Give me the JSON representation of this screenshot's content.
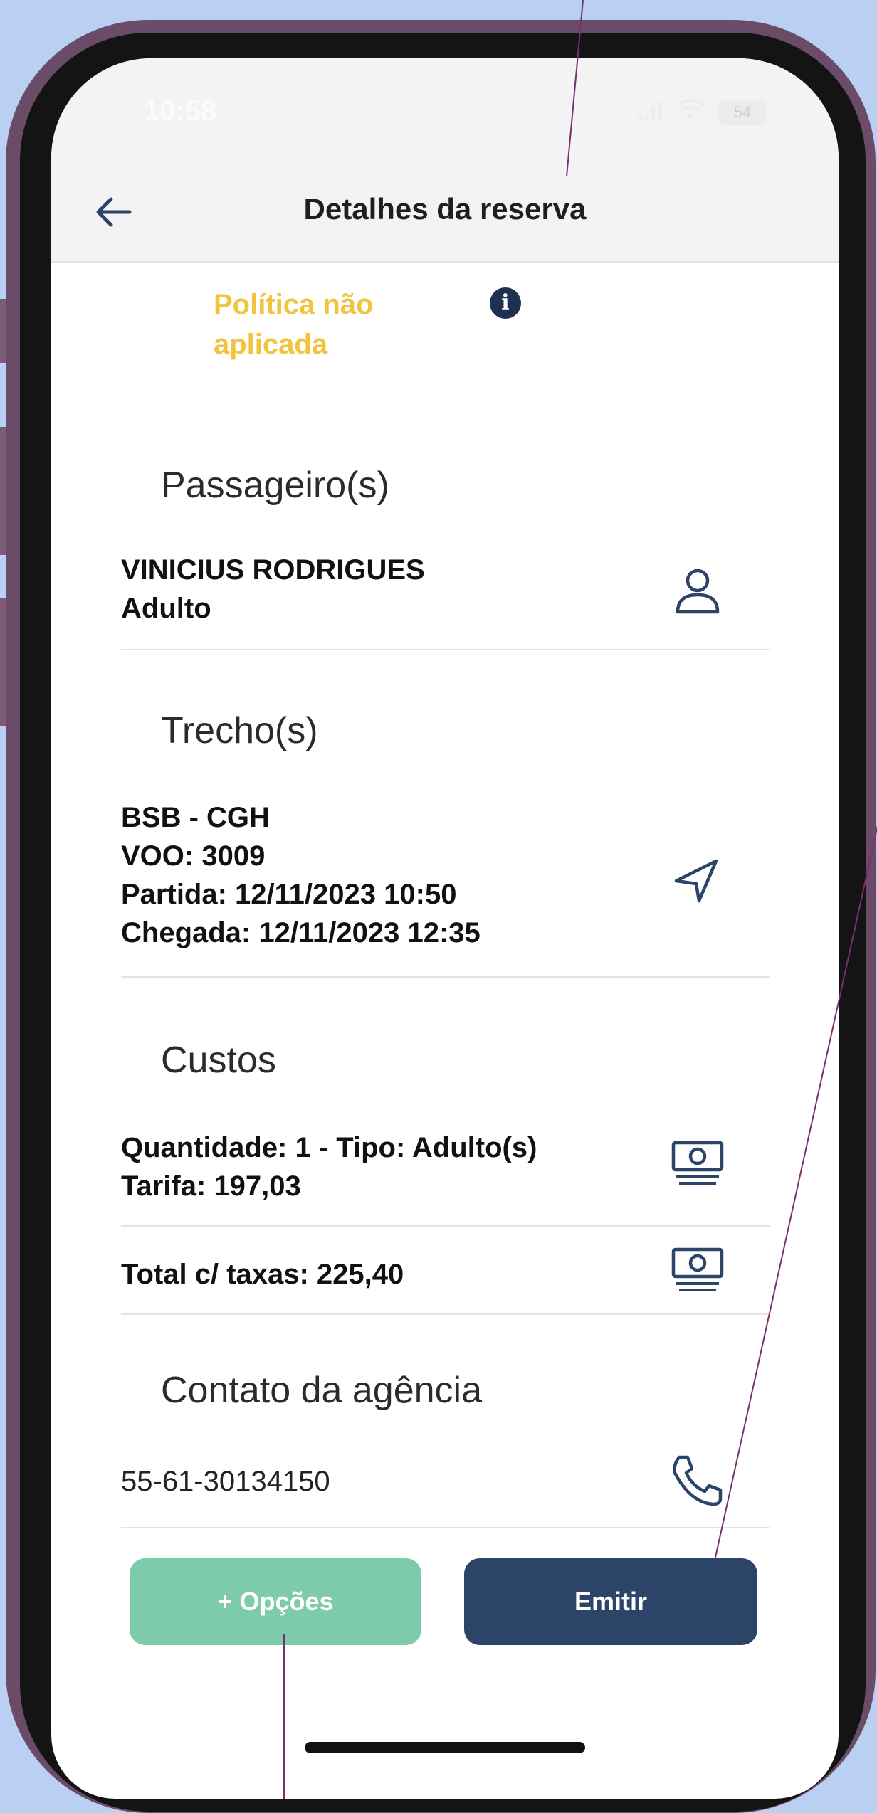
{
  "status_bar": {
    "time": "10:58",
    "signal": "..ıl",
    "battery": "54"
  },
  "header": {
    "title": "Detalhes da reserva"
  },
  "policy": {
    "text": "Política não aplicada"
  },
  "passengers": {
    "title": "Passageiro(s)",
    "name": "VINICIUS RODRIGUES",
    "type": "Adulto"
  },
  "segments": {
    "title": "Trecho(s)",
    "route": "BSB - CGH",
    "flight": "VOO: 3009",
    "departure": "Partida: 12/11/2023 10:50",
    "arrival": "Chegada: 12/11/2023 12:35"
  },
  "costs": {
    "title": "Custos",
    "quantity": "Quantidade: 1 - Tipo: Adulto(s)",
    "fare": "Tarifa: 197,03",
    "total": "Total c/ taxas: 225,40"
  },
  "agency_contact": {
    "title": "Contato da agência",
    "phone": "55-61-30134150"
  },
  "actions": {
    "options_label": "+ Opções",
    "emit_label": "Emitir"
  },
  "colors": {
    "background": "#b9d0f3",
    "policy_warning": "#f2c33d",
    "options_button": "#7ecbab",
    "emit_button": "#2c4467",
    "icon_primary": "#2c4467"
  },
  "icons": [
    "back-arrow-icon",
    "info-icon",
    "user-icon",
    "navigation-arrow-icon",
    "money-icon",
    "phone-icon"
  ]
}
